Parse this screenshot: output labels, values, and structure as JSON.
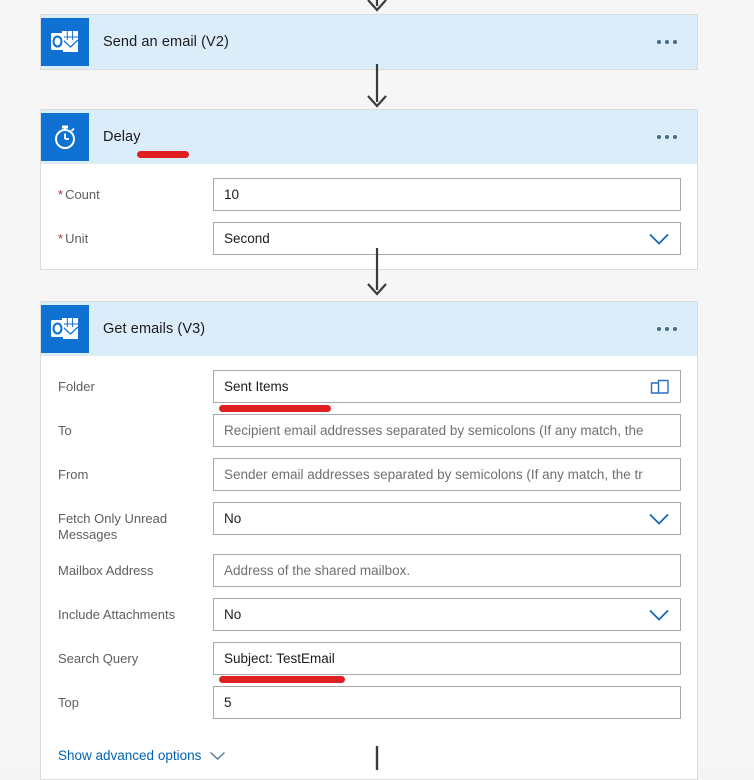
{
  "flow": {
    "steps": [
      {
        "id": "send-email",
        "title": "Send an email (V2)",
        "icon": "outlook-icon",
        "menu_label": "More commands"
      },
      {
        "id": "delay",
        "title": "Delay",
        "icon": "timer-icon",
        "menu_label": "More commands",
        "fields": [
          {
            "label": "Count",
            "required": true,
            "value": "10",
            "type": "text"
          },
          {
            "label": "Unit",
            "required": true,
            "value": "Second",
            "type": "dropdown"
          }
        ]
      },
      {
        "id": "get-emails",
        "title": "Get emails (V3)",
        "icon": "outlook-icon",
        "menu_label": "More commands",
        "fields": [
          {
            "label": "Folder",
            "required": false,
            "value": "Sent Items",
            "type": "picker"
          },
          {
            "label": "To",
            "required": false,
            "value": "",
            "placeholder": "Recipient email addresses separated by semicolons (If any match, the",
            "type": "text"
          },
          {
            "label": "From",
            "required": false,
            "value": "",
            "placeholder": "Sender email addresses separated by semicolons (If any match, the tr",
            "type": "text"
          },
          {
            "label": "Fetch Only Unread Messages",
            "required": false,
            "value": "No",
            "type": "dropdown"
          },
          {
            "label": "Mailbox Address",
            "required": false,
            "value": "",
            "placeholder": "Address of the shared mailbox.",
            "type": "text"
          },
          {
            "label": "Include Attachments",
            "required": false,
            "value": "No",
            "type": "dropdown"
          },
          {
            "label": "Search Query",
            "required": false,
            "value": "Subject: TestEmail",
            "type": "text"
          },
          {
            "label": "Top",
            "required": false,
            "value": "5",
            "type": "text"
          }
        ],
        "advanced_options_label": "Show advanced options"
      }
    ]
  },
  "colors": {
    "header_background": "#dcedfa",
    "icon_background": "#0f72d3",
    "accent_link": "#0063b1",
    "annotation": "#e02020",
    "canvas": "#f6f6f6",
    "required_asterisk": "#a4373a"
  },
  "annotations": [
    {
      "target": "delay-title",
      "type": "red-underline"
    },
    {
      "target": "folder-value",
      "type": "red-underline"
    },
    {
      "target": "search-query-value",
      "type": "red-underline"
    }
  ]
}
